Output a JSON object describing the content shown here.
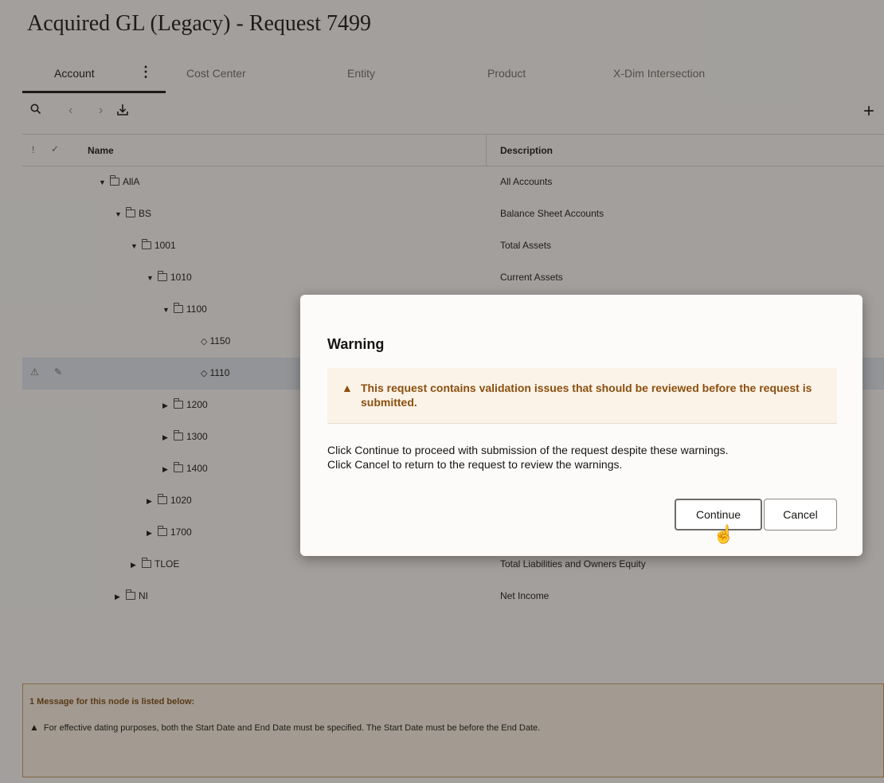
{
  "page": {
    "title": "Acquired GL (Legacy) - Request 7499"
  },
  "tabs": [
    {
      "label": "Account"
    },
    {
      "label": "Cost Center"
    },
    {
      "label": "Entity"
    },
    {
      "label": "Product"
    },
    {
      "label": "X-Dim Intersection"
    }
  ],
  "toolbar": {
    "search_icon": "search-icon",
    "prev_icon": "chevron-left-icon",
    "next_icon": "chevron-right-icon",
    "download_icon": "download-icon",
    "add_icon": "plus-icon"
  },
  "grid": {
    "headers": {
      "issues": "!",
      "status": "✓",
      "name": "Name",
      "description": "Description"
    },
    "rows": [
      {
        "name": "AllA",
        "description": "All Accounts",
        "expander": "expanded",
        "type": "folder"
      },
      {
        "name": "BS",
        "description": "Balance Sheet Accounts",
        "expander": "expanded",
        "type": "folder"
      },
      {
        "name": "1001",
        "description": "Total Assets",
        "expander": "expanded",
        "type": "folder"
      },
      {
        "name": "1010",
        "description": "Current Assets",
        "expander": "expanded",
        "type": "folder"
      },
      {
        "name": "1100",
        "description": "",
        "expander": "expanded",
        "type": "folder"
      },
      {
        "name": "1150",
        "description": "",
        "expander": "none",
        "type": "leaf"
      },
      {
        "name": "1110",
        "description": "",
        "expander": "none",
        "type": "leaf",
        "selected": true,
        "warning": "⚠",
        "edit": "✎"
      },
      {
        "name": "1200",
        "description": "",
        "expander": "collapsed",
        "type": "folder"
      },
      {
        "name": "1300",
        "description": "",
        "expander": "collapsed",
        "type": "folder"
      },
      {
        "name": "1400",
        "description": "",
        "expander": "collapsed",
        "type": "folder"
      },
      {
        "name": "1020",
        "description": "",
        "expander": "collapsed",
        "type": "folder"
      },
      {
        "name": "1700",
        "description": "",
        "expander": "collapsed",
        "type": "folder"
      },
      {
        "name": "TLOE",
        "description": "Total Liabilities and Owners Equity",
        "expander": "collapsed",
        "type": "folder"
      },
      {
        "name": "NI",
        "description": "Net Income",
        "expander": "collapsed",
        "type": "folder"
      }
    ]
  },
  "messages": {
    "title": "1 Message for this node is listed below:",
    "items": [
      "For effective dating purposes, both the Start Date and End Date must be specified. The Start Date must be before the End Date."
    ]
  },
  "dialog": {
    "title": "Warning",
    "banner": "This request contains validation issues that should be reviewed before the request is submitted.",
    "body_line1": "Click Continue to proceed with submission of the request despite these warnings.",
    "body_line2": "Click Cancel to return to the request to review the warnings.",
    "continue_label": "Continue",
    "cancel_label": "Cancel"
  },
  "colors": {
    "warning_text": "#8a4f0e",
    "selected_row": "#dfe6ee",
    "message_panel_bg": "#fbf1e4"
  }
}
